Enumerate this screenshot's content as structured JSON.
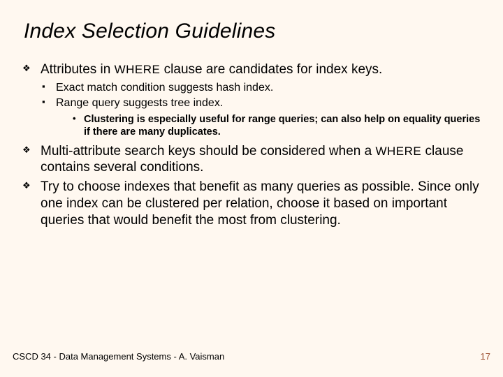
{
  "title": "Index Selection Guidelines",
  "bullets": {
    "b1_pre": "Attributes in ",
    "b1_where": "WHERE",
    "b1_post": " clause are candidates for index keys.",
    "b1_sub1": "Exact match condition suggests hash index.",
    "b1_sub2": "Range query suggests tree index.",
    "b1_sub2_note": "Clustering is especially useful for range queries; can also help on equality queries if there are many duplicates.",
    "b2_pre": "Multi-attribute search keys should be considered when a ",
    "b2_where": "WHERE",
    "b2_post": " clause contains several conditions.",
    "b3": "Try to choose indexes that benefit as many queries as possible.  Since only one index can be clustered per relation, choose it based on important queries that would benefit the most from clustering."
  },
  "footer": {
    "course": "CSCD 34 - Data Management Systems - A. Vaisman",
    "page": "17"
  }
}
